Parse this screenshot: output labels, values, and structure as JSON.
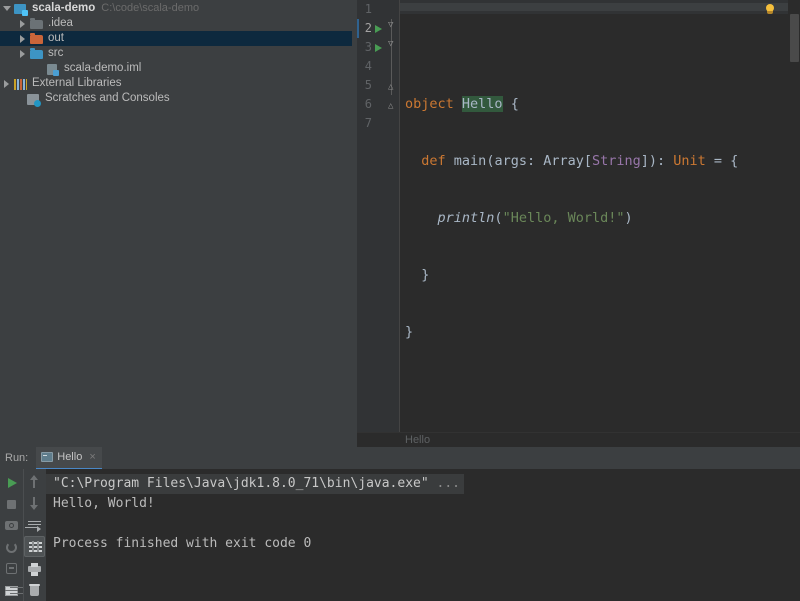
{
  "project": {
    "tree": [
      {
        "label": "scala-demo",
        "path": "C:\\code\\scala-demo"
      },
      {
        "label": ".idea"
      },
      {
        "label": "out"
      },
      {
        "label": "src"
      },
      {
        "label": "scala-demo.iml"
      },
      {
        "label": "External Libraries"
      },
      {
        "label": "Scratches and Consoles"
      }
    ]
  },
  "editor": {
    "filename": "Hello",
    "breadcrumb": "Hello",
    "lines": [
      {
        "num": "1"
      },
      {
        "num": "2"
      },
      {
        "num": "3"
      },
      {
        "num": "4"
      },
      {
        "num": "5"
      },
      {
        "num": "6"
      },
      {
        "num": "7"
      }
    ],
    "tokens": {
      "object_kw": "object",
      "hello_name": "Hello",
      "brace_open": "{",
      "def_kw": "def",
      "main_name": "main",
      "params_a": "(args: Array[",
      "string_type": "String",
      "params_b": "]): ",
      "unit_type": "Unit",
      "params_c": " = {",
      "println_name": "println",
      "hello_string": "\"Hello, World!\"",
      "brace_close": "}"
    },
    "source_text": "\nobject Hello {\n  def main(args: Array[String]): Unit = {\n    println(\"Hello, World!\")\n  }\n}\n",
    "colors": {
      "background": "#2b2b2b",
      "gutter": "#313335",
      "keyword": "#cc7832",
      "string": "#6a8759",
      "type": "#9876aa",
      "default_text": "#a9b7c6",
      "declaration_highlight": "#32593d",
      "line_number": "#606366",
      "run_marker_green": "#499c54",
      "selection_blue": "#0d293e"
    }
  },
  "run": {
    "header_label": "Run:",
    "tab": {
      "label": "Hello",
      "close_glyph": "×"
    },
    "console": [
      {
        "text": "\"C:\\Program Files\\Java\\jdk1.8.0_71\\bin\\java.exe\" ",
        "ellipsis": "..."
      },
      {
        "text": "Hello, World!"
      },
      {
        "text": "Process finished with exit code 0"
      }
    ],
    "toolbar_primary": [
      "rerun-button",
      "stop-button",
      "camera-snapshot-button",
      "restart-button",
      "export-button",
      "layout-settings-button"
    ],
    "toolbar_secondary": [
      "scroll-up-button",
      "scroll-down-button",
      "soft-wrap-button",
      "scroll-to-end-button",
      "print-button",
      "clear-all-button"
    ]
  }
}
